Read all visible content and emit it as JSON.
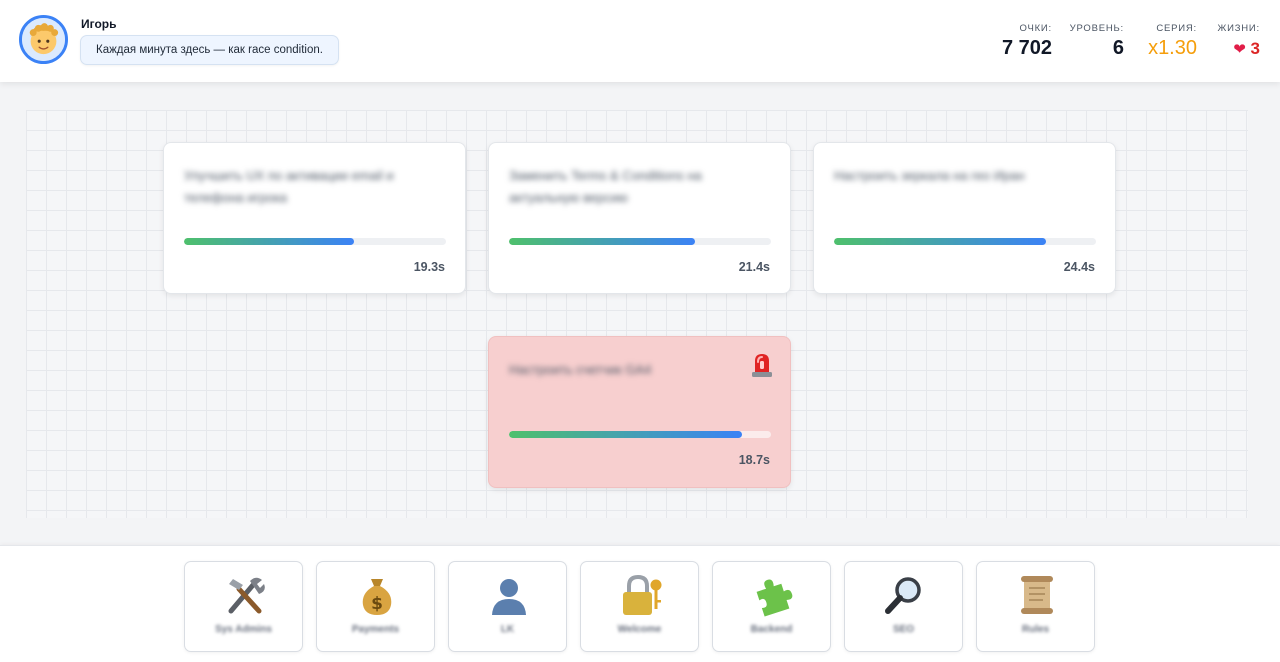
{
  "header": {
    "user_name": "Игорь",
    "message": "Каждая минута здесь — как race condition.",
    "stats": {
      "score_label": "ОЧКИ:",
      "score_value": "7 702",
      "level_label": "УРОВЕНЬ:",
      "level_value": "6",
      "streak_label": "СЕРИЯ:",
      "streak_value": "x1.30",
      "lives_label": "ЖИЗНИ:",
      "lives_value": "3"
    }
  },
  "tasks": [
    {
      "title": "Улучшить UX по активации email и телефона игрока",
      "time": "19.3s",
      "progress": 0.65,
      "alert": false
    },
    {
      "title": "Заменить Terms & Conditions на актуальную версию",
      "time": "21.4s",
      "progress": 0.71,
      "alert": false
    },
    {
      "title": "Настроить зеркала на гео Иран",
      "time": "24.4s",
      "progress": 0.81,
      "alert": false
    },
    {
      "title": "Настроить счетчик GA4",
      "time": "18.7s",
      "progress": 0.89,
      "alert": true
    }
  ],
  "departments": [
    {
      "label": "Sys Admins",
      "icon": "tools-icon"
    },
    {
      "label": "Payments",
      "icon": "money-bag-icon"
    },
    {
      "label": "LK",
      "icon": "user-silhouette-icon"
    },
    {
      "label": "Welcome",
      "icon": "lock-key-icon"
    },
    {
      "label": "Backend",
      "icon": "puzzle-icon"
    },
    {
      "label": "SEO",
      "icon": "magnifier-icon"
    },
    {
      "label": "Rules",
      "icon": "scroll-icon"
    }
  ],
  "colors": {
    "accent": "#3b82f6",
    "progress_start": "#4ec06c",
    "progress_end": "#3b82f6",
    "streak": "#f59e0b",
    "lives": "#dc2626",
    "alert_card": "#f7cfcf"
  }
}
